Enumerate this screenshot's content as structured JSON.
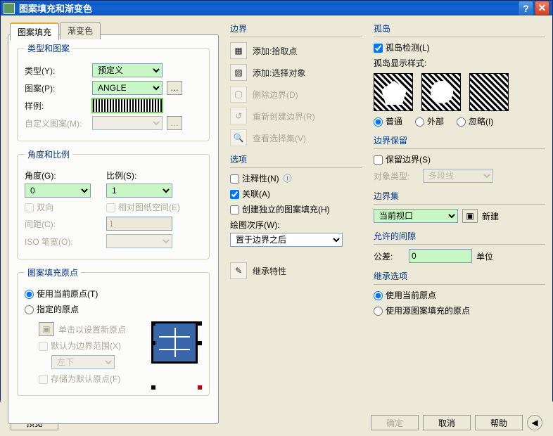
{
  "window": {
    "title": "图案填充和渐变色"
  },
  "tabs": {
    "hatch": "图案填充",
    "gradient": "渐变色"
  },
  "typePattern": {
    "legend": "类型和图案",
    "type_lbl": "类型(Y):",
    "type_val": "预定义",
    "pattern_lbl": "图案(P):",
    "pattern_val": "ANGLE",
    "swatch_lbl": "样例:",
    "custom_lbl": "自定义图案(M):"
  },
  "angleScale": {
    "legend": "角度和比例",
    "angle_lbl": "角度(G):",
    "angle_val": "0",
    "scale_lbl": "比例(S):",
    "scale_val": "1",
    "double": "双向",
    "paperspace": "相对图纸空间(E)",
    "gap_lbl": "间距(C):",
    "gap_val": "1",
    "iso_lbl": "ISO 笔宽(O):",
    "iso_val": ""
  },
  "origin": {
    "legend": "图案填充原点",
    "use_current": "使用当前原点(T)",
    "specified": "指定的原点",
    "click_set": "单击以设置新原点",
    "default_ext": "默认为边界范围(X)",
    "pos_val": "左下",
    "store": "存储为默认原点(F)"
  },
  "boundary": {
    "legend": "边界",
    "add_pick": "添加:拾取点",
    "add_sel": "添加:选择对象",
    "del": "删除边界(D)",
    "recreate": "重新创建边界(R)",
    "viewsel": "查看选择集(V)"
  },
  "options": {
    "legend": "选项",
    "annotative": "注释性(N)",
    "associative": "关联(A)",
    "separate": "创建独立的图案填充(H)",
    "draworder_lbl": "绘图次序(W):",
    "draworder_val": "置于边界之后"
  },
  "inherit_btn": "继承特性",
  "islands": {
    "legend": "孤岛",
    "detect": "孤岛检测(L)",
    "style_lbl": "孤岛显示样式:",
    "normal": "普通",
    "outer": "外部",
    "ignore": "忽略(I)"
  },
  "bretain": {
    "legend": "边界保留",
    "retain": "保留边界(S)",
    "objtype_lbl": "对象类型:",
    "objtype_val": "多段线"
  },
  "bset": {
    "legend": "边界集",
    "val": "当前视口",
    "new": "新建"
  },
  "gap": {
    "legend": "允许的间隙",
    "tol_lbl": "公差:",
    "tol_val": "0",
    "unit": "单位"
  },
  "inheritOpt": {
    "legend": "继承选项",
    "cur": "使用当前原点",
    "src": "使用源图案填充的原点"
  },
  "footer": {
    "preview": "预览",
    "ok": "确定",
    "cancel": "取消",
    "help": "帮助"
  }
}
